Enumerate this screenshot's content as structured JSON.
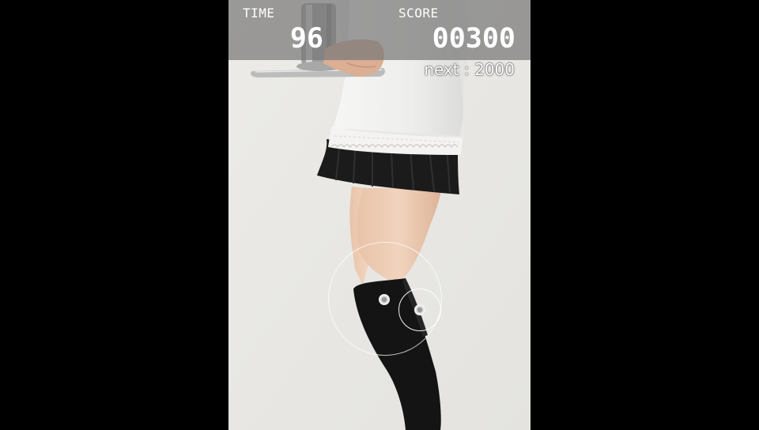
{
  "hud": {
    "time_label": "TIME",
    "time_value": "96",
    "score_label": "SCORE",
    "score_value": "00300",
    "next_label": "next : 2000"
  },
  "colors": {
    "side_bars": "#000000",
    "hud_bar": "#787878",
    "hud_text": "#ffffff",
    "backdrop": "#e9e8e4"
  }
}
